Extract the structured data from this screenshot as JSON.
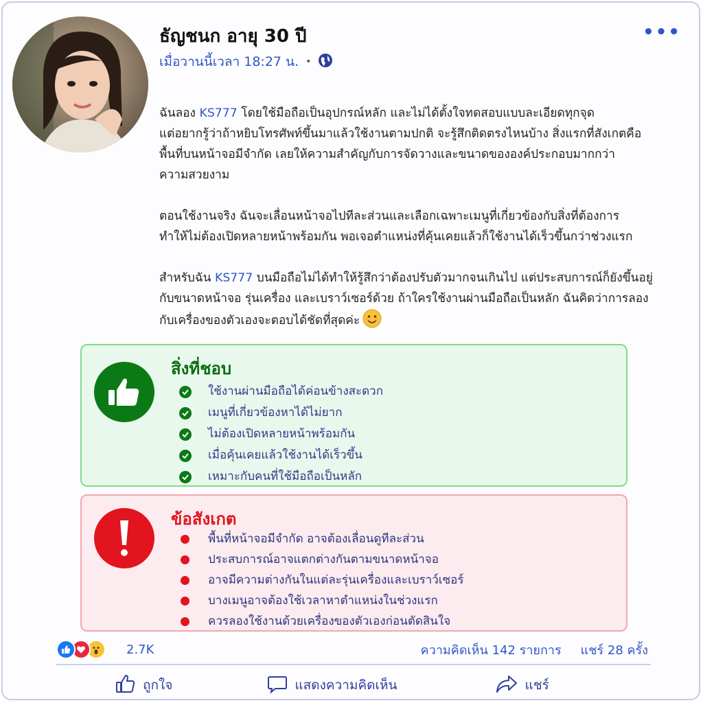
{
  "post": {
    "author": "ธัญชนก อายุ 30 ปี",
    "time": "เมื่อวานนี้เวลา 18:27 น.",
    "paragraph1": {
      "line1_pre": "ฉันลอง ",
      "brand": "KS777",
      "line1_post": " โดยใช้มือถือเป็นอุปกรณ์หลัก และไม่ได้ตั้งใจทดสอบแบบละเอียดทุกจุด",
      "line2": "แต่อยากรู้ว่าถ้าหยิบโทรศัพท์ขึ้นมาแล้วใช้งานตามปกติ จะรู้สึกติดตรงไหนบ้าง สิ่งแรกที่สังเกตคือ",
      "line3": "พื้นที่บนหน้าจอมีจำกัด เลยให้ความสำคัญกับการจัดวางและขนาดขององค์ประกอบมากกว่า",
      "line4": "ความสวยงาม"
    },
    "paragraph2": {
      "line1": "ตอนใช้งานจริง ฉันจะเลื่อนหน้าจอไปทีละส่วนและเลือกเฉพาะเมนูที่เกี่ยวข้องกับสิ่งที่ต้องการ",
      "line2": "ทำให้ไม่ต้องเปิดหลายหน้าพร้อมกัน พอเจอตำแหน่งที่คุ้นเคยแล้วก็ใช้งานได้เร็วขึ้นกว่าช่วงแรก"
    },
    "paragraph3": {
      "line1_pre": "สำหรับฉัน ",
      "brand": "KS777",
      "line1_post": " บนมือถือไม่ได้ทำให้รู้สึกว่าต้องปรับตัวมากจนเกินไป แต่ประสบการณ์ก็ยังขึ้นอยู่",
      "line2": "กับขนาดหน้าจอ รุ่นเครื่อง และเบราว์เซอร์ด้วย ถ้าใครใช้งานผ่านมือถือเป็นหลัก ฉันคิดว่าการลอง",
      "line3": "กับเครื่องของตัวเองจะตอบได้ชัดที่สุดค่ะ"
    }
  },
  "likes_box": {
    "title": "สิ่งที่ชอบ",
    "items": [
      "ใช้งานผ่านมือถือได้ค่อนข้างสะดวก",
      "เมนูที่เกี่ยวข้องหาได้ไม่ยาก",
      "ไม่ต้องเปิดหลายหน้าพร้อมกัน",
      "เมื่อคุ้นเคยแล้วใช้งานได้เร็วขึ้น",
      "เหมาะกับคนที่ใช้มือถือเป็นหลัก"
    ]
  },
  "notes_box": {
    "title": "ข้อสังเกต",
    "items": [
      "พื้นที่หน้าจอมีจำกัด อาจต้องเลื่อนดูทีละส่วน",
      "ประสบการณ์อาจแตกต่างกันตามขนาดหน้าจอ",
      "อาจมีความต่างกันในแต่ละรุ่นเครื่องและเบราว์เซอร์",
      "บางเมนูอาจต้องใช้เวลาหาตำแหน่งในช่วงแรก",
      "ควรลองใช้งานด้วยเครื่องของตัวเองก่อนตัดสินใจ"
    ]
  },
  "stats": {
    "reactions": "2.7K",
    "comments": "ความคิดเห็น 142 รายการ",
    "shares": "แชร์  28 ครั้ง"
  },
  "actions": {
    "like": "ถูกใจ",
    "comment": "แสดงความคิดเห็น",
    "share": "แชร์"
  },
  "colors": {
    "accent": "#2f56c8",
    "like_green": "#0b7a16",
    "note_red": "#e2141e"
  },
  "icons": [
    "more-dots-icon",
    "globe-icon",
    "thumbs-up-icon",
    "exclamation-icon",
    "check-icon",
    "smile-emoji-icon",
    "heart-icon",
    "wow-icon",
    "comment-icon",
    "share-icon"
  ]
}
